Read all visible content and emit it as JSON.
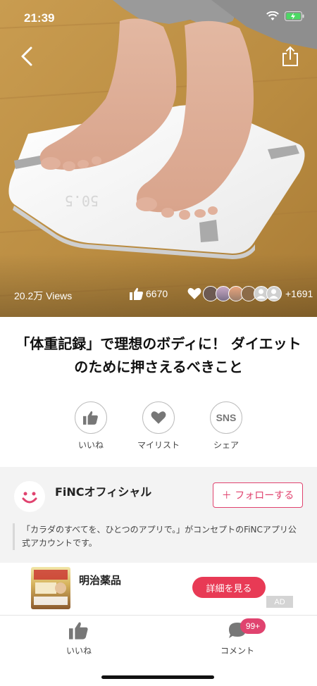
{
  "status": {
    "time": "21:39"
  },
  "article": {
    "views": "20.2万 Views",
    "likes": "6670",
    "favorites_extra": "+1691",
    "title": "「体重記録」で理想のボディに！ ダイエットのために押さえるべきこと",
    "scale_display": "50.5"
  },
  "actions": {
    "like": "いいね",
    "mylist": "マイリスト",
    "share": "シェア",
    "sns": "SNS"
  },
  "official": {
    "name": "FiNCオフィシャル",
    "follow": "＋ フォローする",
    "description": "「カラダのすべてを、ひとつのアプリで。」がコンセプトのFiNCアプリ公式アカウントです。"
  },
  "ad": {
    "advertiser": "明治薬品",
    "cta": "詳細を見る",
    "badge": "AD"
  },
  "bottom": {
    "like": "いいね",
    "comment": "コメント",
    "comment_count": "99+"
  },
  "colors": {
    "accent": "#e0436f",
    "cta": "#e83a55"
  }
}
